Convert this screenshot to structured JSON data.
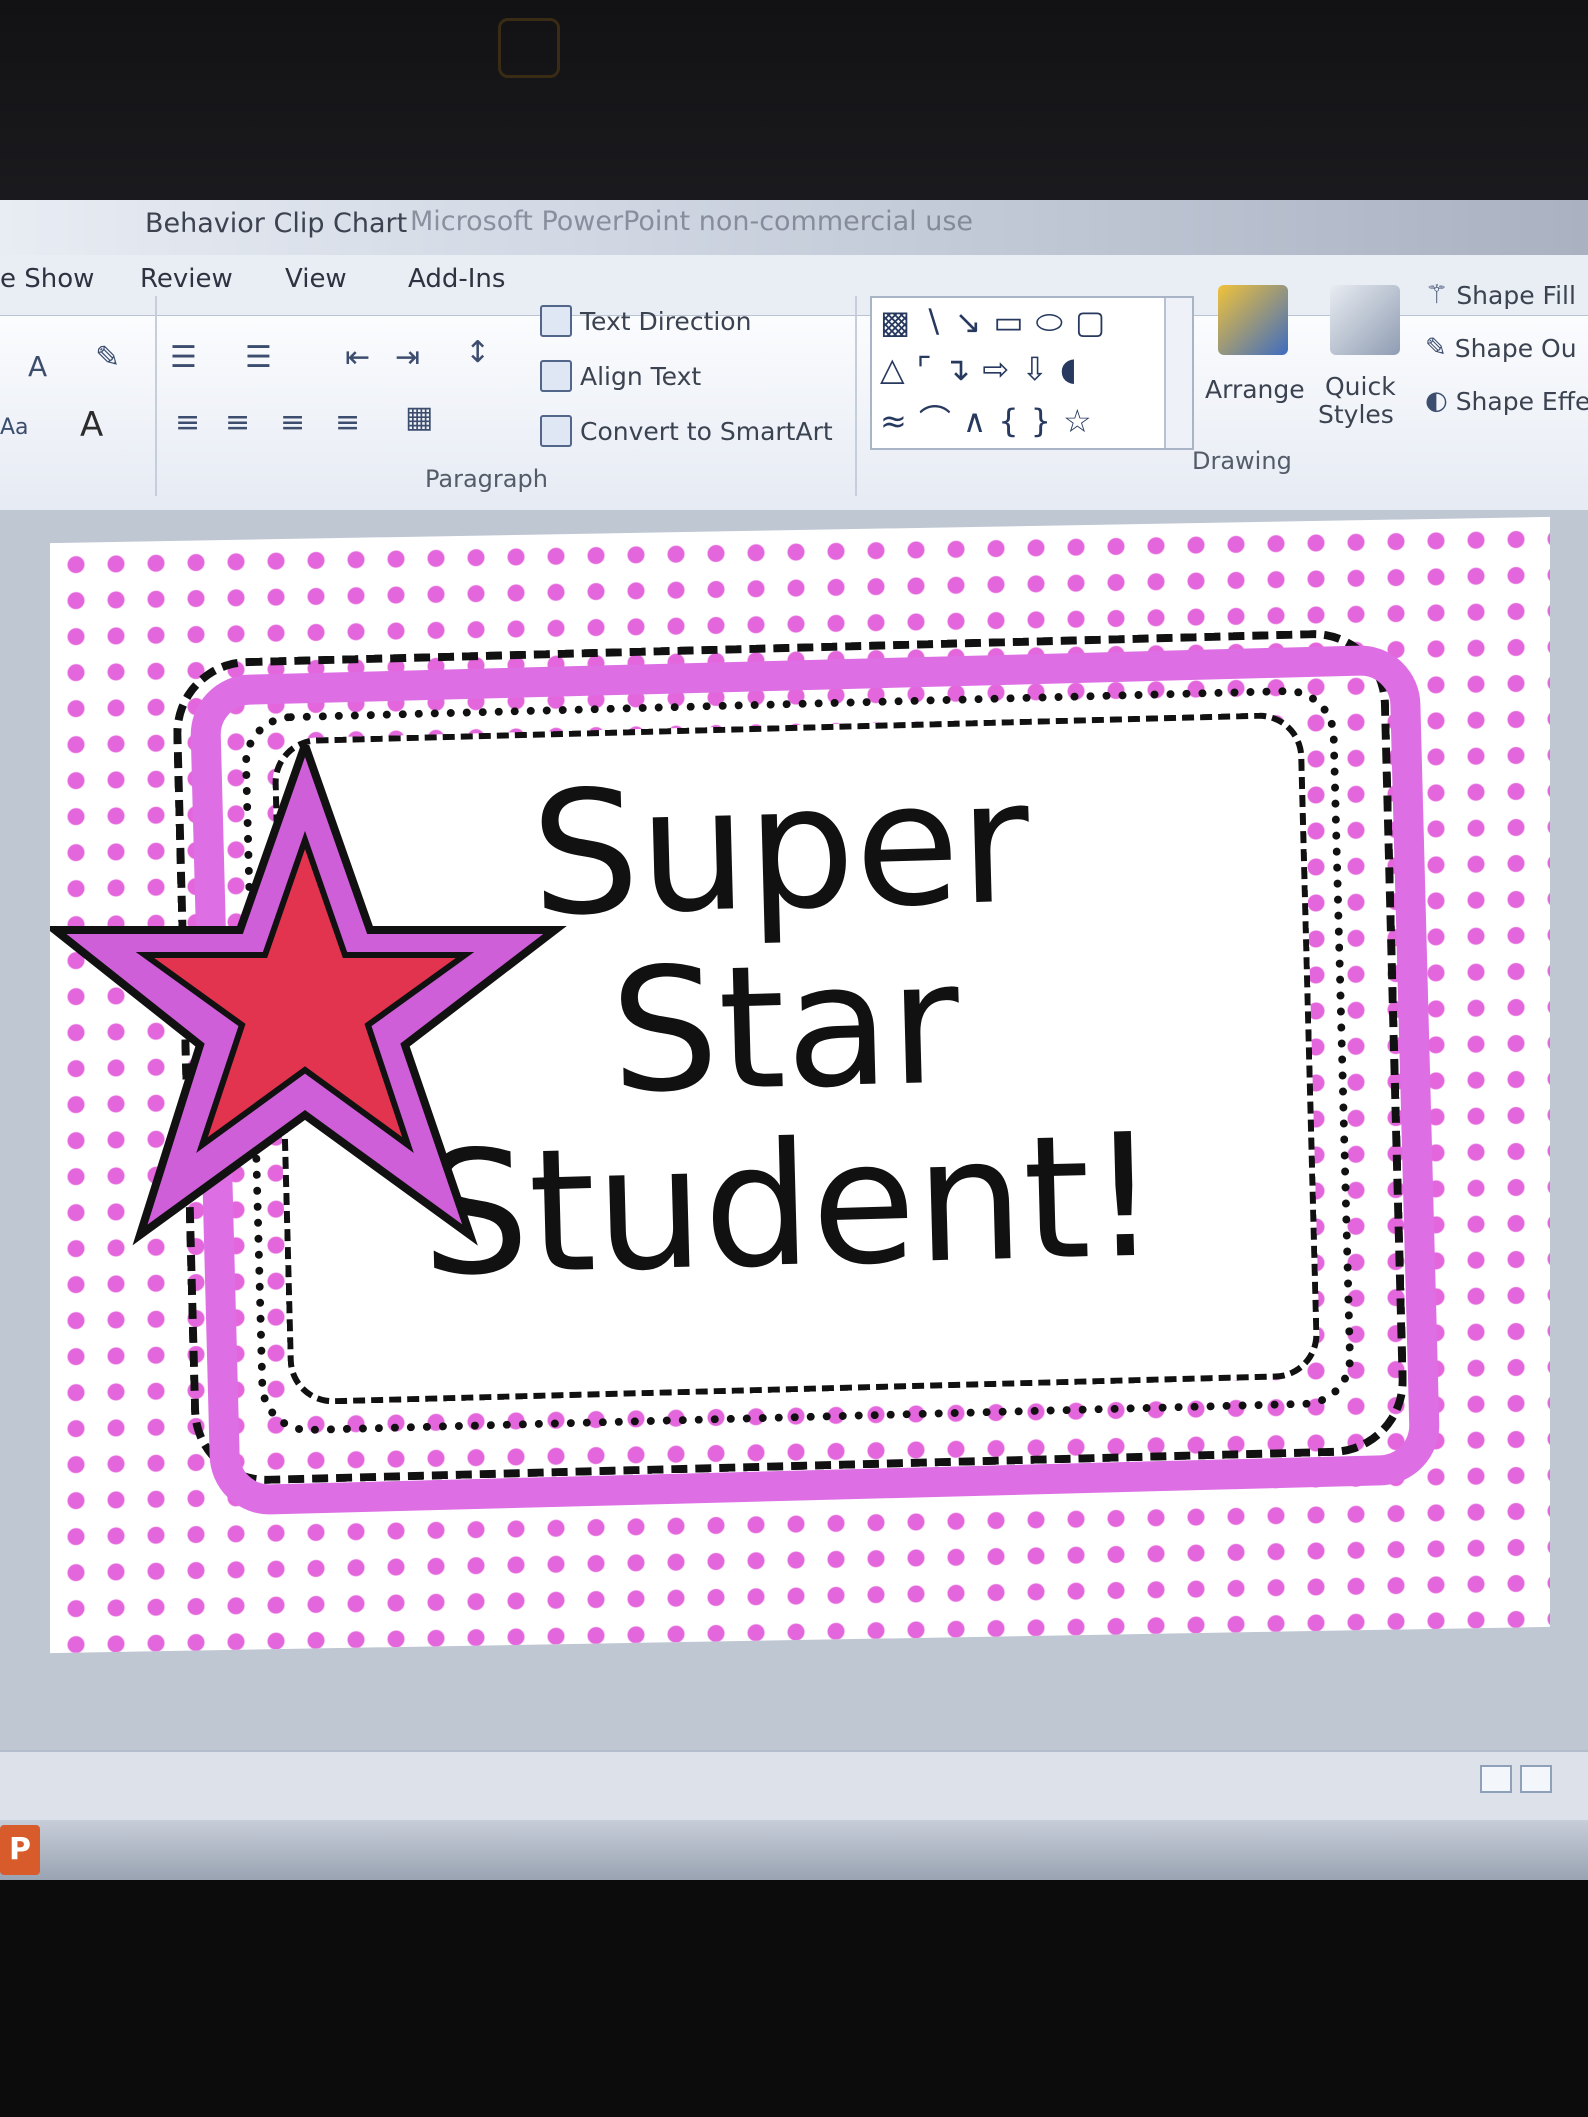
{
  "window": {
    "title": "Behavior Clip Chart",
    "title_suffix": "Microsoft PowerPoint non-commercial use"
  },
  "tabs": [
    {
      "label": "e Show"
    },
    {
      "label": "Review"
    },
    {
      "label": "View"
    },
    {
      "label": "Add-Ins"
    }
  ],
  "ribbon": {
    "paragraph": {
      "group_label": "Paragraph",
      "text_direction": "Text Direction",
      "align_text": "Align Text",
      "convert_smartart": "Convert to SmartArt"
    },
    "drawing": {
      "group_label": "Drawing",
      "arrange": "Arrange",
      "quick_styles_line1": "Quick",
      "quick_styles_line2": "Styles",
      "shape_fill": "Shape Fill",
      "shape_outline": "Shape Ou",
      "shape_effects": "Shape Effe"
    },
    "font_partial": {
      "a_small": "A",
      "aa": "Aa",
      "a_big": "A"
    }
  },
  "slide": {
    "text": "Super\nStar\nStudent!",
    "colors": {
      "dots": "#e466dc",
      "frame": "#dd6ee4",
      "star_outer": "#cf5fd8",
      "star_inner": "#e2334f",
      "outline": "#111111"
    }
  },
  "status": {
    "icons": [
      "normal-view-icon",
      "slide-sorter-icon"
    ]
  }
}
